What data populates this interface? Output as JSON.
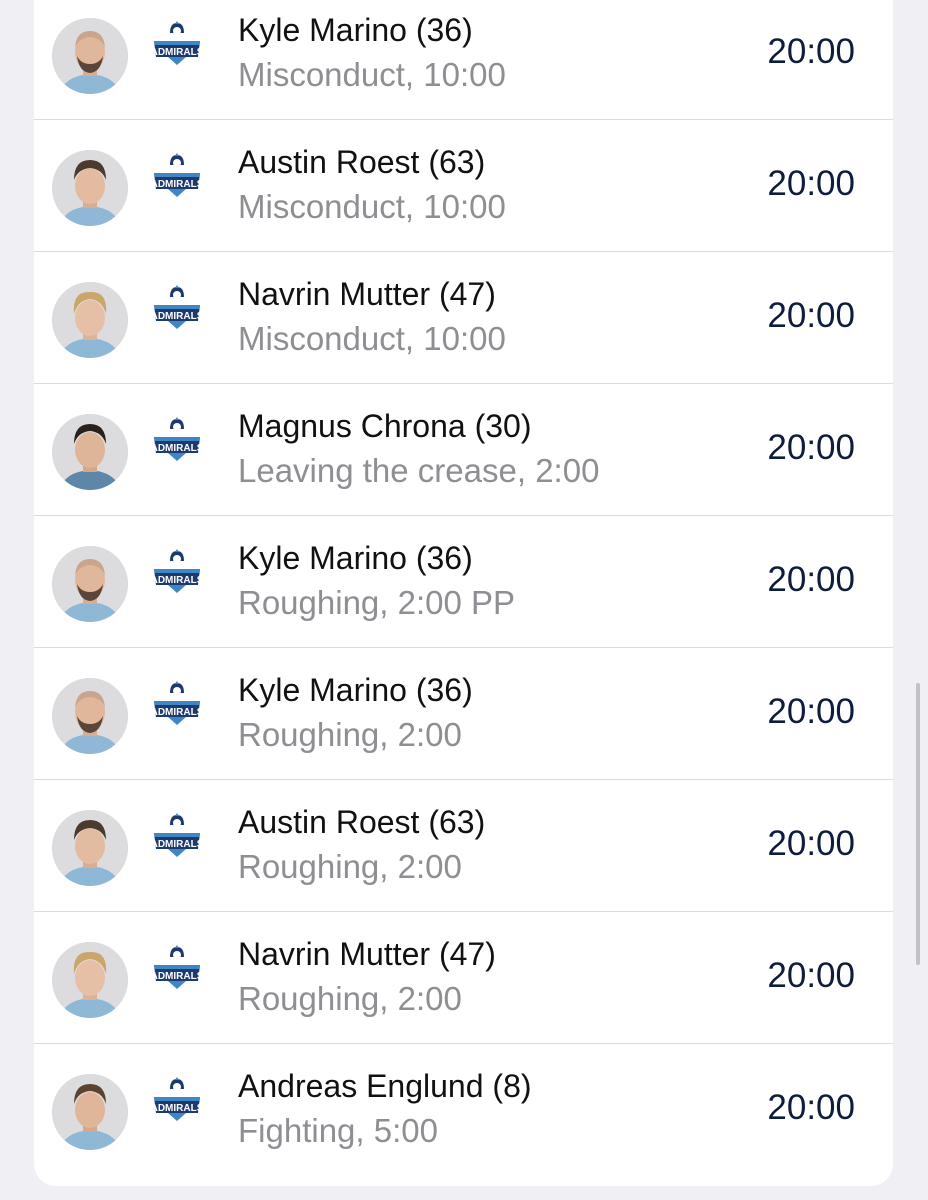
{
  "colors": {
    "background": "#efeff4",
    "card": "#ffffff",
    "name_text": "#111111",
    "detail_text": "#8e8e93",
    "time_text": "#0f1d3d",
    "logo_navy": "#1d3a70",
    "logo_blue": "#3f86c5"
  },
  "penalties": [
    {
      "player": "Kyle Marino (36)",
      "infraction": "Misconduct, 10:00",
      "time": "20:00",
      "team_icon": "admirals-logo-icon",
      "avatar_icon": "player-headshot-avatar"
    },
    {
      "player": "Austin Roest (63)",
      "infraction": "Misconduct, 10:00",
      "time": "20:00",
      "team_icon": "admirals-logo-icon",
      "avatar_icon": "player-headshot-avatar"
    },
    {
      "player": "Navrin Mutter (47)",
      "infraction": "Misconduct, 10:00",
      "time": "20:00",
      "team_icon": "admirals-logo-icon",
      "avatar_icon": "player-headshot-avatar"
    },
    {
      "player": "Magnus Chrona (30)",
      "infraction": "Leaving the crease, 2:00",
      "time": "20:00",
      "team_icon": "admirals-logo-icon",
      "avatar_icon": "player-headshot-avatar"
    },
    {
      "player": "Kyle Marino (36)",
      "infraction": "Roughing, 2:00 PP",
      "time": "20:00",
      "team_icon": "admirals-logo-icon",
      "avatar_icon": "player-headshot-avatar"
    },
    {
      "player": "Kyle Marino (36)",
      "infraction": "Roughing, 2:00",
      "time": "20:00",
      "team_icon": "admirals-logo-icon",
      "avatar_icon": "player-headshot-avatar"
    },
    {
      "player": "Austin Roest (63)",
      "infraction": "Roughing, 2:00",
      "time": "20:00",
      "team_icon": "admirals-logo-icon",
      "avatar_icon": "player-headshot-avatar"
    },
    {
      "player": "Navrin Mutter (47)",
      "infraction": "Roughing, 2:00",
      "time": "20:00",
      "team_icon": "admirals-logo-icon",
      "avatar_icon": "player-headshot-avatar"
    },
    {
      "player": "Andreas Englund (8)",
      "infraction": "Fighting, 5:00",
      "time": "20:00",
      "team_icon": "admirals-logo-icon",
      "avatar_icon": "player-headshot-avatar"
    }
  ]
}
